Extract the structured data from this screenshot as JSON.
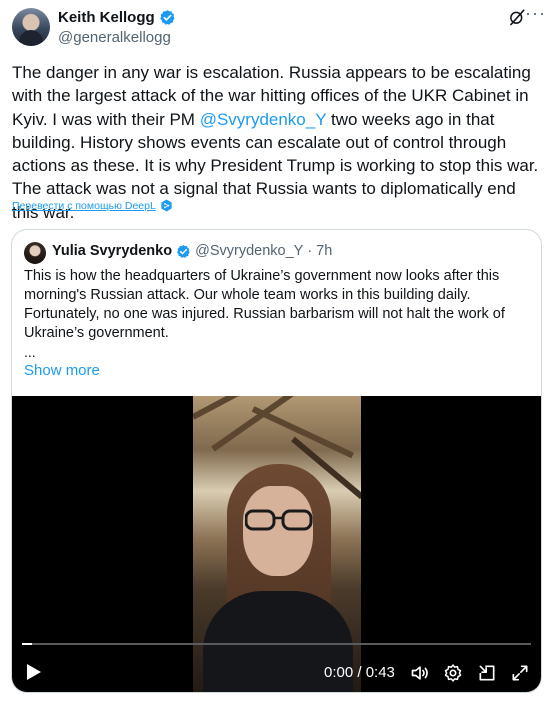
{
  "author": {
    "name": "Keith Kellogg",
    "handle": "@generalkellogg"
  },
  "tweet": {
    "text_part1": "The danger in any war is escalation. Russia appears to be escalating with the largest attack of the war hitting offices of the UKR Cabinet in Kyiv. I was with their PM ",
    "mention": "@Svyrydenko_Y",
    "text_part2": " two weeks ago in that building. History shows events can escalate out of control through actions as these. It is why President Trump is working to stop this war. The attack was not a signal that Russia wants to diplomatically end this war.",
    "translate_label": "Перевести с помощью DeepL"
  },
  "quote": {
    "name": "Yulia Svyrydenko",
    "handle": "@Svyrydenko_Y",
    "separator": "·",
    "time": "7h",
    "text": "This is how the headquarters of Ukraine’s government now looks after this morning's Russian attack. Our whole team works in this building daily. Fortunately, no one was injured. Russian barbarism will not halt the work of Ukraine’s government.",
    "ellipsis": "...",
    "show_more": "Show more"
  },
  "video": {
    "time_display": "0:00 / 0:43",
    "progress_fraction": 0.02
  },
  "colors": {
    "accent": "#1d9bf0",
    "text": "#0f1419",
    "muted": "#536471",
    "border": "#cfd9de"
  },
  "icons": {
    "verified": "verified-badge-icon",
    "grok": "grok-icon",
    "more": "more-options-icon",
    "deepl": "deepl-icon",
    "play": "play-icon",
    "volume": "volume-icon",
    "settings": "settings-icon",
    "pip": "picture-in-picture-icon",
    "fullscreen": "fullscreen-icon"
  }
}
